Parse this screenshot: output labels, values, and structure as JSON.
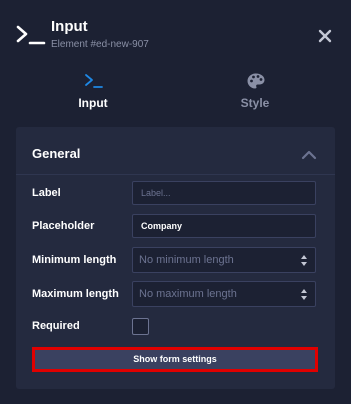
{
  "header": {
    "title": "Input",
    "subtitle": "Element #ed-new-907",
    "icon": "terminal-prompt-icon",
    "close_icon": "close-icon"
  },
  "tabs": [
    {
      "label": "Input",
      "icon": "terminal-prompt-icon",
      "active": true
    },
    {
      "label": "Style",
      "icon": "palette-icon",
      "active": false
    }
  ],
  "panel": {
    "title": "General",
    "collapse_icon": "chevron-up-icon",
    "fields": {
      "label": {
        "label": "Label",
        "value": "",
        "placeholder": "Label..."
      },
      "placeholder": {
        "label": "Placeholder",
        "value": "Company",
        "placeholder": ""
      },
      "min_length": {
        "label": "Minimum length",
        "selected": "No minimum length"
      },
      "max_length": {
        "label": "Maximum length",
        "selected": "No maximum length"
      },
      "required": {
        "label": "Required",
        "checked": false
      }
    },
    "settings_button": "Show form settings"
  },
  "colors": {
    "background": "#1c2133",
    "panel": "#242a3f",
    "accent": "#1e88e5",
    "muted_text": "#8a90a6",
    "highlight_border": "#e00000"
  }
}
